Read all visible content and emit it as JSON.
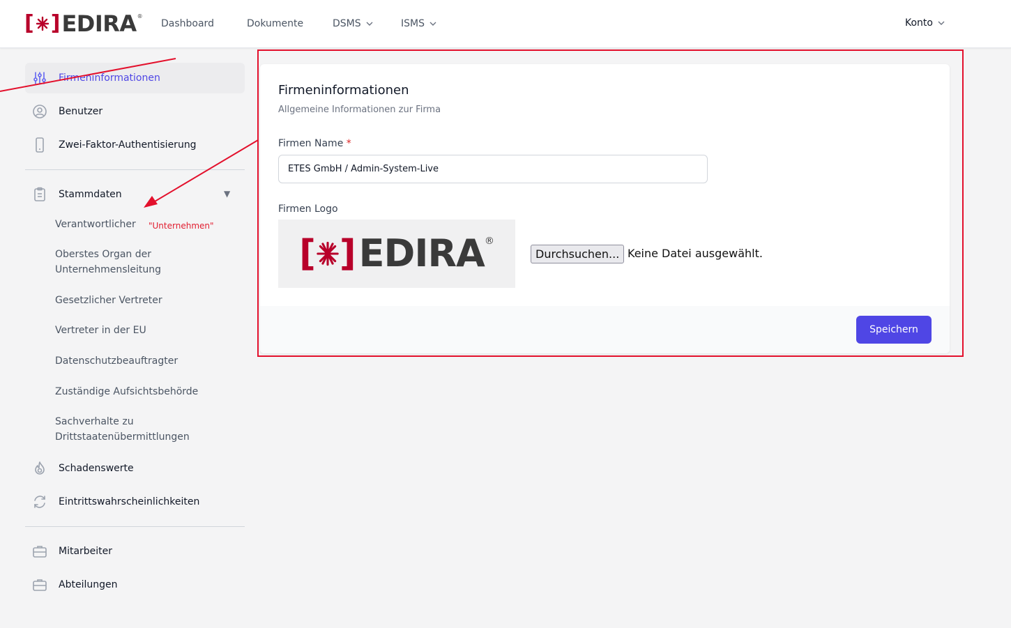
{
  "header": {
    "brand": {
      "bracket_left": "[",
      "bracket_right": "]",
      "name": "EDIRA",
      "reg": "®"
    },
    "nav": [
      {
        "label": "Dashboard",
        "has_dropdown": false
      },
      {
        "label": "Dokumente",
        "has_dropdown": false
      },
      {
        "label": "DSMS",
        "has_dropdown": true
      },
      {
        "label": "ISMS",
        "has_dropdown": true
      }
    ],
    "account_label": "Konto"
  },
  "sidebar": {
    "items": [
      {
        "label": "Firmeninformationen",
        "icon": "sliders-icon",
        "active": true
      },
      {
        "label": "Benutzer",
        "icon": "user-circle-icon"
      },
      {
        "label": "Zwei-Faktor-Authentisierung",
        "icon": "phone-icon"
      },
      {
        "label": "Stammdaten",
        "icon": "clipboard-icon"
      },
      {
        "label": "Schadenswerte",
        "icon": "fire-icon"
      },
      {
        "label": "Eintrittswahrscheinlichkeiten",
        "icon": "refresh-icon"
      },
      {
        "label": "Mitarbeiter",
        "icon": "briefcase-icon"
      },
      {
        "label": "Abteilungen",
        "icon": "briefcase-icon"
      }
    ],
    "stammdaten_caret": "▼",
    "subitems": [
      "Verantwortlicher",
      "Oberstes Organ der Unternehmensleitung",
      "Gesetzlicher Vertreter",
      "Vertreter in der EU",
      "Datenschutzbeauftragter",
      "Zuständige Aufsichtsbehörde",
      "Sachverhalte zu Drittstaatenübermittlungen"
    ],
    "annotation": "\"Unternehmen\""
  },
  "card": {
    "title": "Firmeninformationen",
    "subtitle": "Allgemeine Informationen zur Firma",
    "name_label": "Firmen Name",
    "required_mark": "*",
    "name_value": "ETES GmbH / Admin-System-Live",
    "logo_label": "Firmen Logo",
    "logo_brand": {
      "bracket_left": "[",
      "bracket_right": "]",
      "name": "EDIRA",
      "reg": "®"
    },
    "file_button": "Durchsuchen...",
    "file_status": "Keine Datei ausgewählt.",
    "save_button": "Speichern"
  },
  "colors": {
    "accent": "#4f46e5",
    "brand_red": "#b8002a",
    "annotation_red": "#e3102c"
  }
}
